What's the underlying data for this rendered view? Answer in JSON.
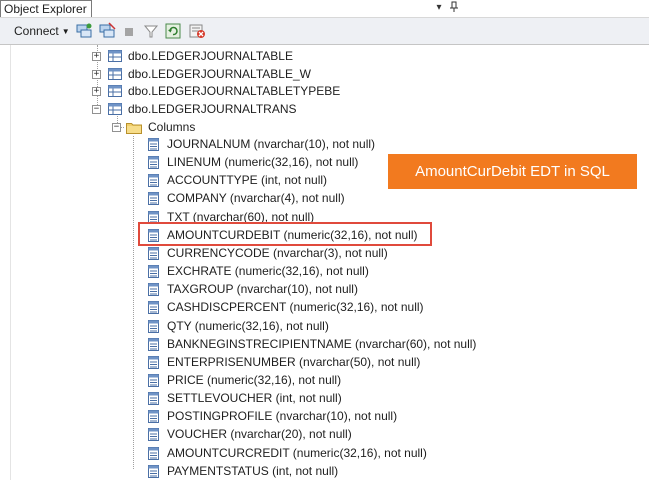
{
  "panel": {
    "title": "Object Explorer",
    "pin_glyph": "▾",
    "dock_glyph": "⊥"
  },
  "toolbar": {
    "connect_label": "Connect",
    "connect_caret": "▼",
    "icons": [
      "connect-object-explorer-icon",
      "disconnect-icon",
      "stop-icon",
      "filter-icon",
      "refresh-icon",
      "delete-icon"
    ]
  },
  "tree": {
    "tables": [
      {
        "label": "dbo.LEDGERJOURNALTABLE",
        "expanded": false
      },
      {
        "label": "dbo.LEDGERJOURNALTABLE_W",
        "expanded": false
      },
      {
        "label": "dbo.LEDGERJOURNALTABLETYPEBE",
        "expanded": false
      },
      {
        "label": "dbo.LEDGERJOURNALTRANS",
        "expanded": true
      }
    ],
    "folder": {
      "label": "Columns",
      "expanded": true
    },
    "columns": [
      "JOURNALNUM (nvarchar(10), not null)",
      "LINENUM (numeric(32,16), not null)",
      "ACCOUNTTYPE (int, not null)",
      "COMPANY (nvarchar(4), not null)",
      "TXT (nvarchar(60), not null)",
      "AMOUNTCURDEBIT (numeric(32,16), not null)",
      "CURRENCYCODE (nvarchar(3), not null)",
      "EXCHRATE (numeric(32,16), not null)",
      "TAXGROUP (nvarchar(10), not null)",
      "CASHDISCPERCENT (numeric(32,16), not null)",
      "QTY (numeric(32,16), not null)",
      "BANKNEGINSTRECIPIENTNAME (nvarchar(60), not null)",
      "ENTERPRISENUMBER (nvarchar(50), not null)",
      "PRICE (numeric(32,16), not null)",
      "SETTLEVOUCHER (int, not null)",
      "POSTINGPROFILE (nvarchar(10), not null)",
      "VOUCHER (nvarchar(20), not null)",
      "AMOUNTCURCREDIT (numeric(32,16), not null)",
      "PAYMENTSTATUS (int, not null)"
    ],
    "highlighted_column": "AMOUNTCURDEBIT (numeric(32,16), not null)"
  },
  "callout": {
    "text": "AmountCurDebit EDT in SQL",
    "color": "#f27a1f"
  },
  "colors": {
    "highlight_border": "#e04a3c",
    "toolbar_bg": "#eef0f4"
  }
}
